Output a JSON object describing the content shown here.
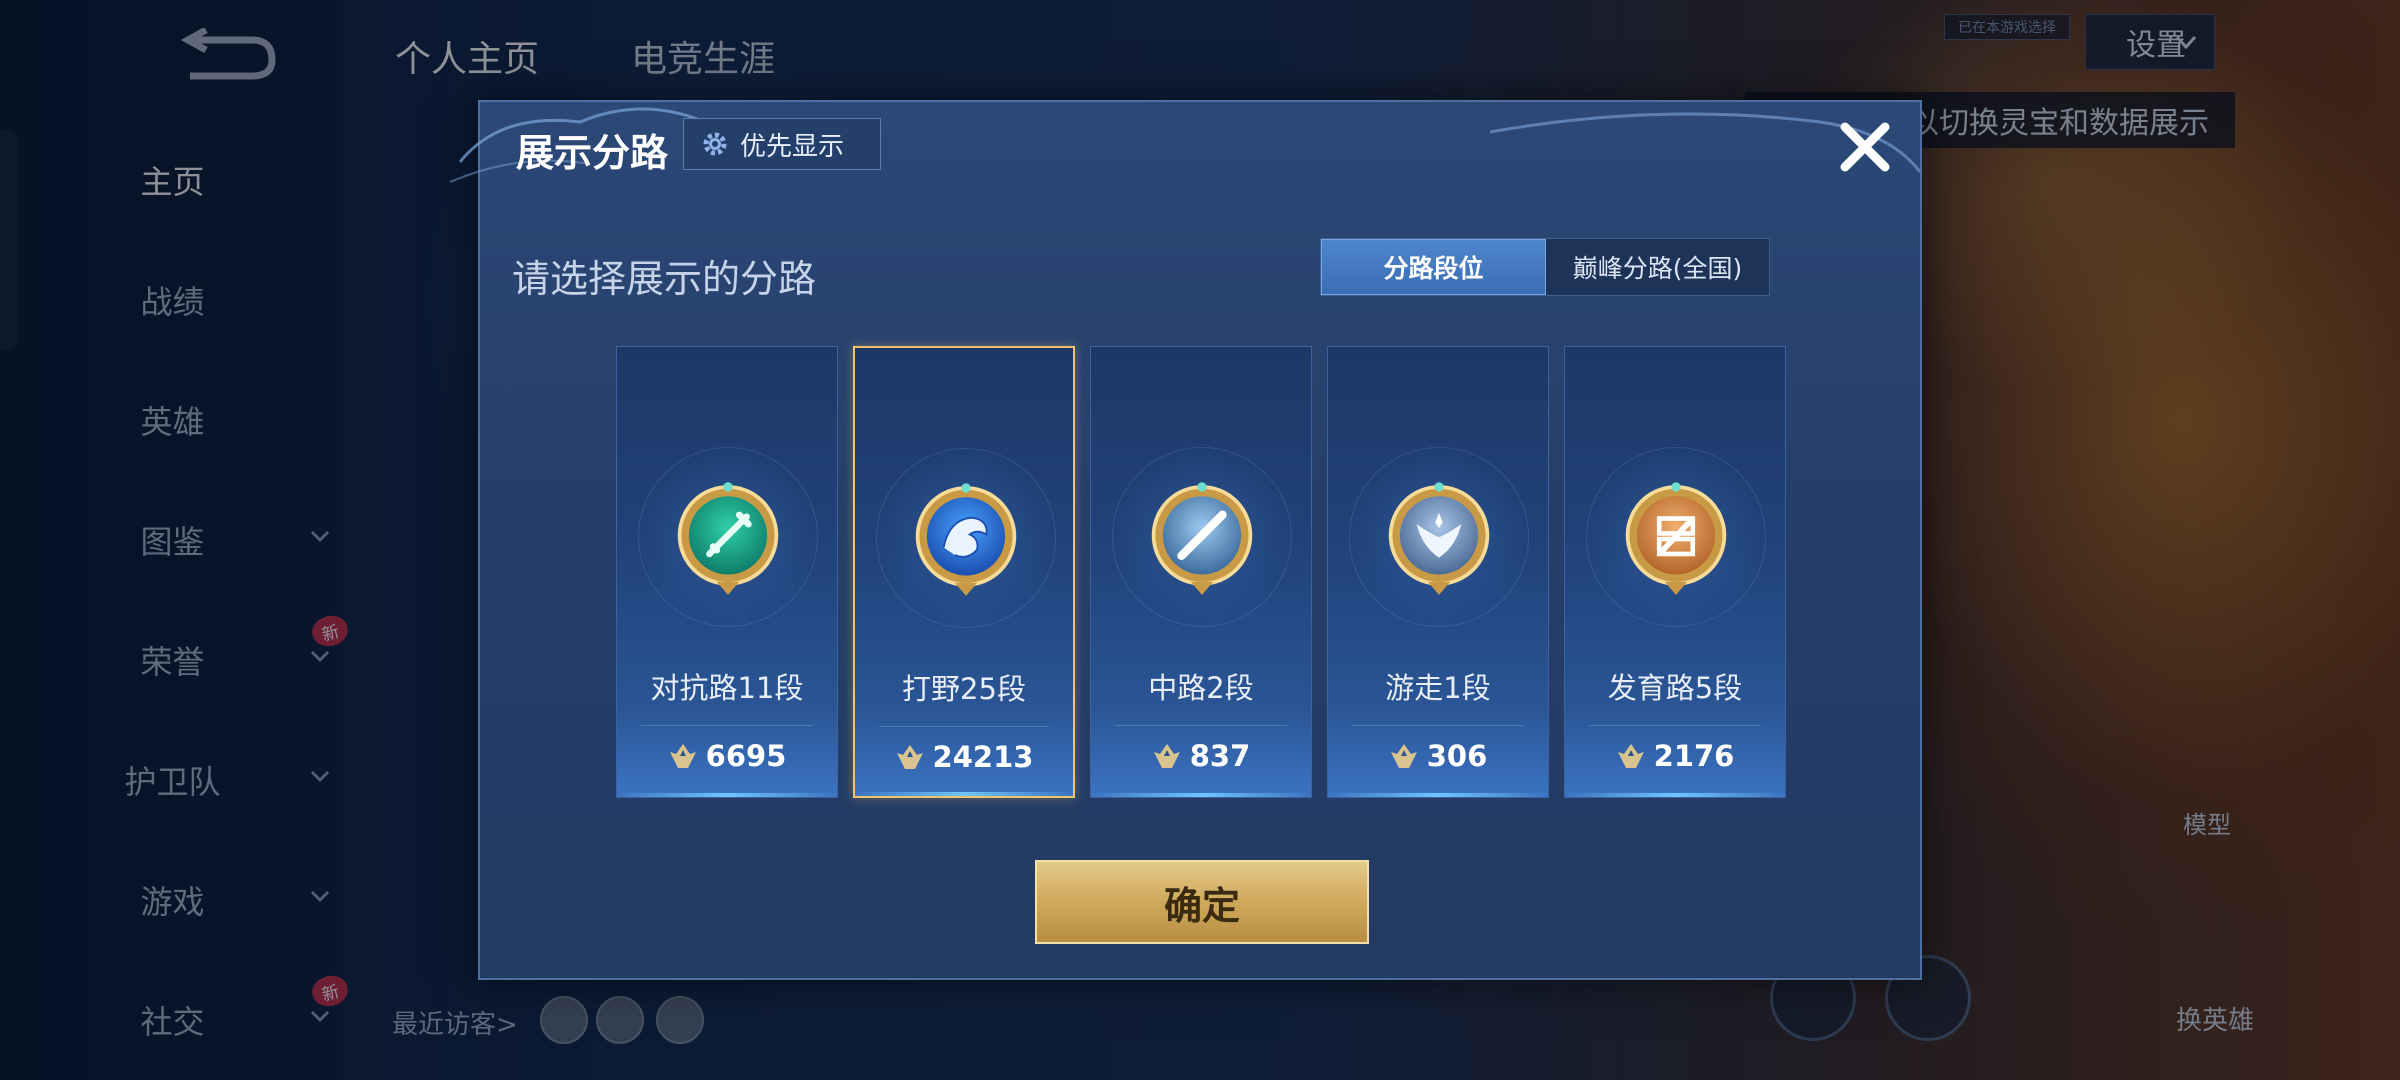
{
  "background": {
    "profile_tabs": [
      "个人主页",
      "电竞生涯"
    ],
    "settings_label": "设置",
    "small_tag": "已在本游戏选择",
    "tip_text": "以切换灵宝和数据展示",
    "nav_items": [
      {
        "label": "主页",
        "active": true,
        "new": false
      },
      {
        "label": "战绩",
        "active": false,
        "new": false
      },
      {
        "label": "英雄",
        "active": false,
        "new": false
      },
      {
        "label": "图鉴",
        "active": false,
        "new": false,
        "chevron": true
      },
      {
        "label": "荣誉",
        "active": false,
        "new": true,
        "chevron": true
      },
      {
        "label": "护卫队",
        "active": false,
        "new": false,
        "chevron": true
      },
      {
        "label": "游戏",
        "active": false,
        "new": false,
        "chevron": true
      },
      {
        "label": "社交",
        "active": false,
        "new": true,
        "chevron": true
      }
    ],
    "new_badge": "新",
    "recent_visitors_label": "最近访客>",
    "model_label": "模型",
    "switch_hero_label": "换英雄"
  },
  "dialog": {
    "title": "展示分路",
    "priority_button": "优先显示",
    "prompt": "请选择展示的分路",
    "toggle": [
      {
        "label": "分路段位",
        "active": true
      },
      {
        "label": "巅峰分路(全国)",
        "active": false
      }
    ],
    "cards": [
      {
        "label": "对抗路11段",
        "score": "6695",
        "selected": false,
        "emblem": "sword-emblem-icon",
        "colors": [
          "#2fd0a8",
          "#0f7d6a"
        ]
      },
      {
        "label": "打野25段",
        "score": "24213",
        "selected": true,
        "emblem": "dragon-emblem-icon",
        "colors": [
          "#4aa3ff",
          "#1b4fb0"
        ]
      },
      {
        "label": "中路2段",
        "score": "837",
        "selected": false,
        "emblem": "slash-emblem-icon",
        "colors": [
          "#9cc9ee",
          "#3d6d9e"
        ]
      },
      {
        "label": "游走1段",
        "score": "306",
        "selected": false,
        "emblem": "wings-emblem-icon",
        "colors": [
          "#a9c4e6",
          "#4d6c96"
        ]
      },
      {
        "label": "发育路5段",
        "score": "2176",
        "selected": false,
        "emblem": "bow-emblem-icon",
        "colors": [
          "#f0b070",
          "#b5662a"
        ]
      }
    ],
    "confirm_button": "确定",
    "accent": "#f0c46a"
  }
}
